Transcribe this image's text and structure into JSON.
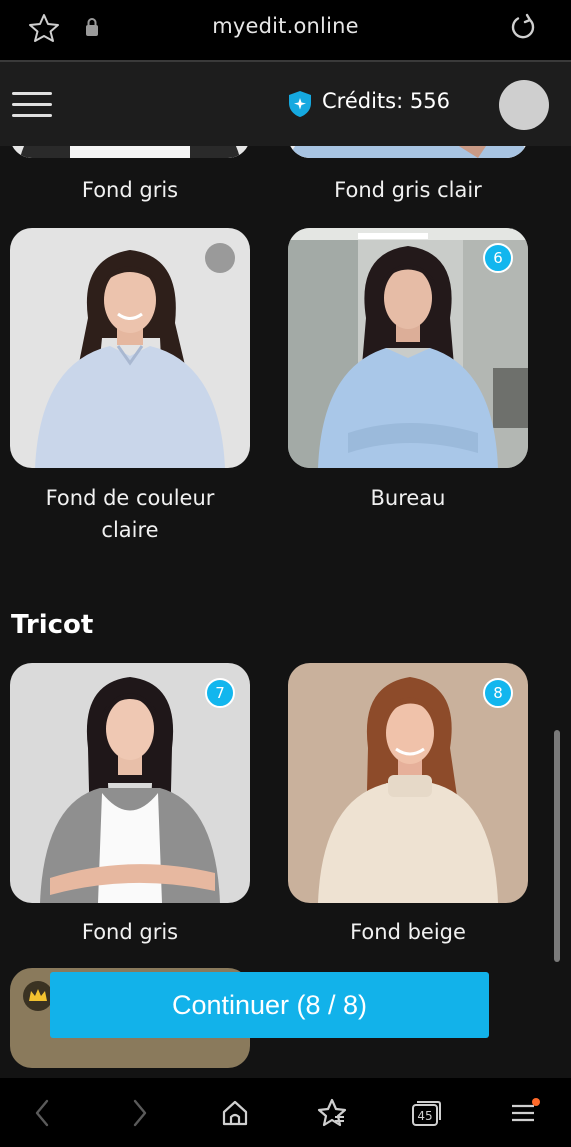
{
  "browser": {
    "url": "myedit.online",
    "icons": [
      "star-icon",
      "lock-icon",
      "reload-icon"
    ]
  },
  "header": {
    "credits_label": "Crédits: 556",
    "icons": [
      "hamburger-menu-icon",
      "credits-shield-icon",
      "avatar"
    ]
  },
  "items_top": [
    {
      "caption": "Fond gris"
    },
    {
      "caption": "Fond gris clair"
    }
  ],
  "items_row2": [
    {
      "caption": "Fond de couleur claire",
      "badge": ""
    },
    {
      "caption": "Bureau",
      "badge": "6"
    }
  ],
  "section": {
    "title": "Tricot",
    "items": [
      {
        "caption": "Fond gris",
        "badge": "7"
      },
      {
        "caption": "Fond beige",
        "badge": "8"
      }
    ]
  },
  "continue_label": "Continuer (8 / 8)",
  "bottom_nav": {
    "tabs_count": "45",
    "icons": [
      "back-icon",
      "forward-icon",
      "home-icon",
      "favorites-icon",
      "tabs-icon",
      "menu-icon"
    ],
    "notification_color": "#ff6a2a"
  },
  "colors": {
    "accent": "#12b2ea",
    "background": "#131313"
  }
}
